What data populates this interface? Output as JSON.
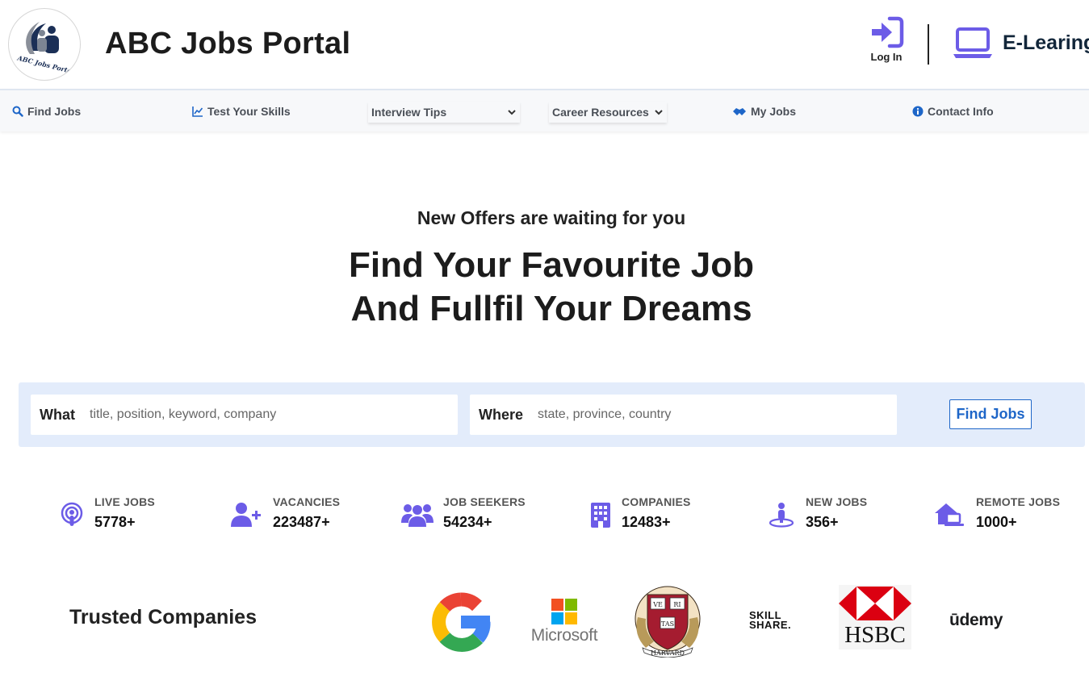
{
  "header": {
    "site_title": "ABC Jobs Portal",
    "logo_text": "ABC Jobs Portal",
    "login_label": "Log In",
    "elearning_label": "E-Learing"
  },
  "nav": {
    "find_jobs": "Find Jobs",
    "test_skills": "Test Your Skills",
    "interview_tips": "Interview Tips",
    "career_resources": "Career Resources",
    "my_jobs": "My Jobs",
    "contact_info": "Contact Info"
  },
  "hero": {
    "subtitle": "New Offers are waiting for you",
    "title_line1": "Find Your Favourite Job",
    "title_line2": "And Fullfil Your Dreams"
  },
  "search": {
    "what_label": "What",
    "what_placeholder": "title, position, keyword, company",
    "what_value": "",
    "where_label": "Where",
    "where_placeholder": "state, province, country",
    "where_value": "",
    "button_label": "Find Jobs"
  },
  "stats": [
    {
      "label": "LIVE JOBS",
      "value": "5778+",
      "icon": "podcast-icon"
    },
    {
      "label": "VACANCIES",
      "value": "223487+",
      "icon": "user-plus-icon"
    },
    {
      "label": "JOB SEEKERS",
      "value": "54234+",
      "icon": "users-icon"
    },
    {
      "label": "COMPANIES",
      "value": "12483+",
      "icon": "building-icon"
    },
    {
      "label": "NEW JOBS",
      "value": "356+",
      "icon": "person-pin-icon"
    },
    {
      "label": "REMOTE JOBS",
      "value": "1000+",
      "icon": "house-laptop-icon"
    }
  ],
  "trusted": {
    "title": "Trusted Companies",
    "companies": [
      "Google",
      "Microsoft",
      "Harvard",
      "Skillshare",
      "HSBC",
      "udemy"
    ],
    "microsoft_text": "Microsoft",
    "hsbc_text": "HSBC",
    "skillshare_line1": "SKILL",
    "skillshare_line2": "SHARE.",
    "udemy_text": "ūdemy",
    "harvard_text": "HARVARD",
    "harvard_motto": [
      "VE",
      "RI",
      "TAS"
    ]
  },
  "colors": {
    "accent": "#6c63ff",
    "link_blue": "#1e66c8",
    "search_bg": "#e3ecfb",
    "nav_bg": "#f7f8fa"
  }
}
